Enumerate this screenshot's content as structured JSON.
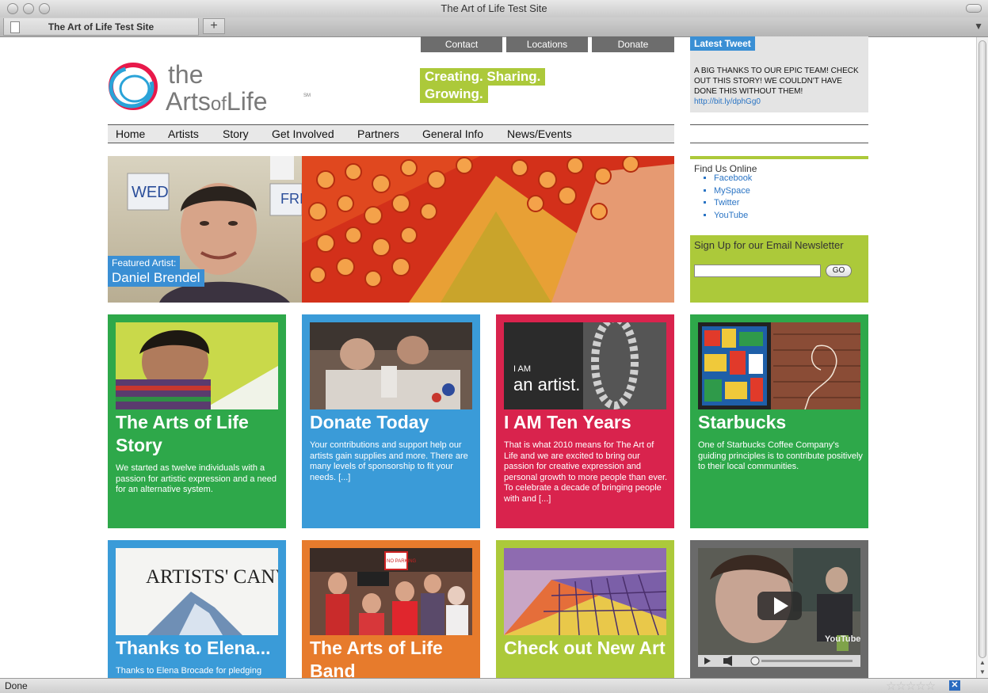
{
  "browser": {
    "window_title": "The Art of Life Test Site",
    "tab_label": "The Art of Life Test Site",
    "new_tab_symbol": "+",
    "status_text": "Done"
  },
  "top_links": [
    "Contact",
    "Locations",
    "Donate"
  ],
  "logo": {
    "line1": "the",
    "line2a": "Arts",
    "line2b": "of",
    "line2c": "Life",
    "mark": "SM"
  },
  "slogan": {
    "line1": "Creating. Sharing.",
    "line2": "Growing."
  },
  "nav": [
    "Home",
    "Artists",
    "Story",
    "Get Involved",
    "Partners",
    "General Info",
    "News/Events"
  ],
  "tweet": {
    "heading": "Latest Tweet",
    "text": "A BIG THANKS TO OUR EPIC TEAM! CHECK OUT THIS STORY! WE COULDN'T HAVE DONE THIS WITHOUT THEM!",
    "link": "http://bit.ly/dphGg0"
  },
  "featured": {
    "label": "Featured Artist:",
    "name": "Daniel Brendel",
    "sign_text_1": "WED",
    "sign_text_2": "FRI"
  },
  "find_us": {
    "heading": "Find Us Online",
    "links": [
      "Facebook",
      "MySpace",
      "Twitter",
      "YouTube"
    ]
  },
  "newsletter": {
    "heading": "Sign Up for our Email Newsletter",
    "button": "GO"
  },
  "tiles": [
    {
      "title": "The Arts of Life Story",
      "text": "We started as twelve individuals with a passion for artistic expression and a need for an alternative system.",
      "color": "#2ea84a"
    },
    {
      "title": "Donate Today",
      "text": "Your contributions and support help our artists gain supplies and more. There are many levels of sponsorship to fit your needs. [...]",
      "color": "#3a9bd8"
    },
    {
      "title": "I AM Ten Years",
      "text": "That is what 2010 means for The Art of Life and we are excited to bring our passion for creative expression and personal growth to more people than ever. To celebrate a decade of bringing people with and [...]",
      "color": "#d9234d",
      "image_text_1": "I AM",
      "image_text_2": "an artist."
    },
    {
      "title": "Starbucks",
      "text": "One of Starbucks Coffee Company's guiding principles is to contribute positively to their local communities.",
      "color": "#2ea84a"
    },
    {
      "title": "Thanks to Elena...",
      "text": "Thanks to Elena Brocade for pledging",
      "color": "#3a9bd8",
      "image_text": "ARTISTS' CANV"
    },
    {
      "title": "The Arts of Life Band",
      "text": "",
      "color": "#e77b2c",
      "image_text": "NO PARKING"
    },
    {
      "title": "Check out New Art",
      "text": "",
      "color": "#acc93a"
    },
    {
      "title": "",
      "text": "",
      "color": "#6a6a6a",
      "image_text": "YouTube"
    }
  ]
}
